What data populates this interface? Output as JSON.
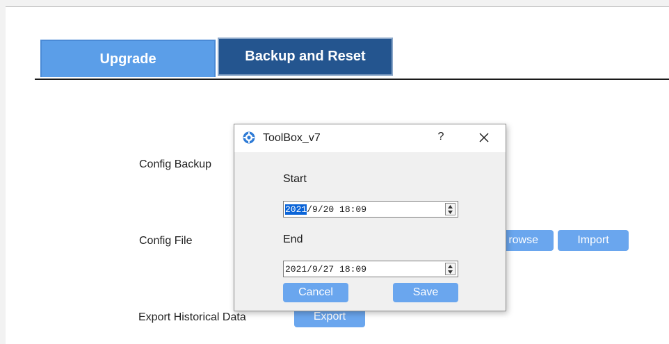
{
  "tabs": [
    {
      "label": "Upgrade",
      "active": false
    },
    {
      "label": "Backup and Reset",
      "active": true
    }
  ],
  "rows": {
    "config_backup": {
      "label": "Config Backup"
    },
    "config_file": {
      "label": "Config File",
      "browse_label": "rowse",
      "import_label": "Import"
    },
    "export_historical": {
      "label": "Export Historical Data",
      "export_label": "Export"
    }
  },
  "dialog": {
    "title": "ToolBox_v7",
    "help": "?",
    "start_label": "Start",
    "start_year": "2021",
    "start_rest": "/9/20 18:09",
    "end_label": "End",
    "end_value": "2021/9/27 18:09",
    "cancel_label": "Cancel",
    "save_label": "Save"
  },
  "icons": {
    "app": "gear-icon",
    "close": "close-icon",
    "spin_up": "chevron-up-icon",
    "spin_down": "chevron-down-icon"
  },
  "colors": {
    "tab_inactive": "#5b9ee8",
    "tab_active": "#24558f",
    "button": "#6aa6ee",
    "selection": "#0a64d8"
  }
}
